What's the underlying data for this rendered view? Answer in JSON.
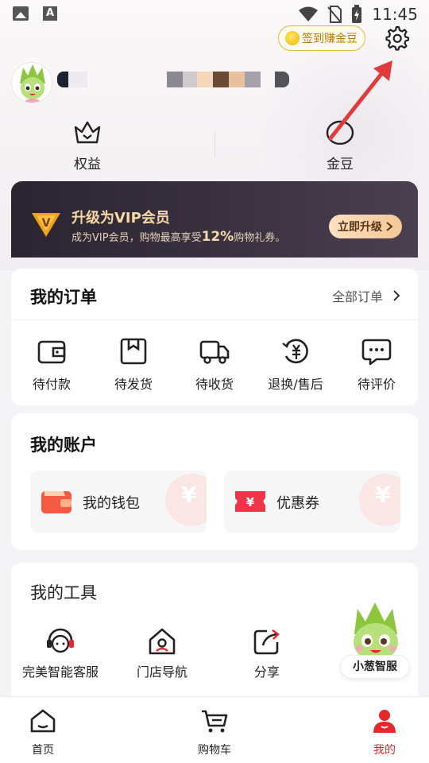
{
  "status_bar": {
    "time": "11:45",
    "notif_a": "A"
  },
  "header": {
    "checkin_label": "签到赚金豆"
  },
  "stats": [
    {
      "label": "权益"
    },
    {
      "label": "金豆"
    }
  ],
  "vip": {
    "title": "升级为VIP会员",
    "desc_prefix": "成为VIP会员，购物最高享受",
    "desc_highlight": "12%",
    "desc_suffix": "购物礼券。",
    "button": "立即升级",
    "logo_letter": "V"
  },
  "orders": {
    "title": "我的订单",
    "all_label": "全部订单",
    "items": [
      {
        "label": "待付款",
        "icon": "wallet-icon"
      },
      {
        "label": "待发货",
        "icon": "package-icon"
      },
      {
        "label": "待收货",
        "icon": "truck-icon"
      },
      {
        "label": "退换/售后",
        "icon": "refund-icon"
      },
      {
        "label": "待评价",
        "icon": "comment-icon"
      }
    ]
  },
  "account": {
    "title": "我的账户",
    "items": [
      {
        "label": "我的钱包",
        "icon": "wallet-icon"
      },
      {
        "label": "优惠券",
        "icon": "coupon-icon"
      }
    ],
    "deco_symbol": "¥"
  },
  "tools": {
    "title": "我的工具",
    "items": [
      {
        "label": "完美智能客服",
        "icon": "customer-service-icon"
      },
      {
        "label": "门店导航",
        "icon": "store-icon"
      },
      {
        "label": "分享",
        "icon": "share-icon"
      }
    ]
  },
  "assistant": {
    "label": "小葱智服"
  },
  "tabbar": {
    "items": [
      {
        "label": "首页",
        "icon": "home-icon"
      },
      {
        "label": "购物车",
        "icon": "cart-icon"
      },
      {
        "label": "我的",
        "icon": "profile-icon"
      }
    ]
  },
  "colors": {
    "accent": "#e8262b",
    "gold": "#e8b83a",
    "vip_dark": "#2a2430"
  }
}
